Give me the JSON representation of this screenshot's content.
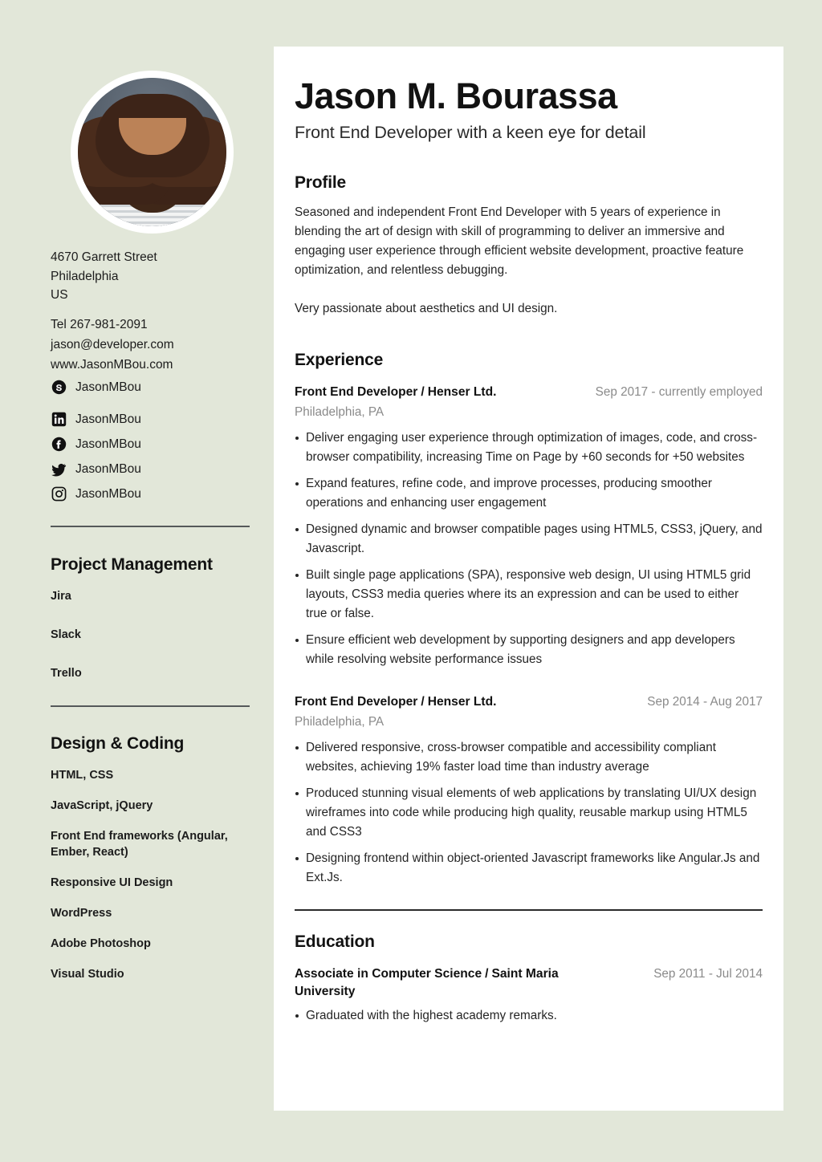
{
  "theme": {
    "background": "#E2E7D9",
    "panel": "#FFFFFF",
    "text": "#252525",
    "muted": "#8A8A8A",
    "rule": "#2B2B2B",
    "sidebar_rule": "#55595A"
  },
  "sidebar": {
    "photo_alt": "portrait-photo",
    "address": {
      "street": "4670 Garrett Street",
      "city": "Philadelphia",
      "country": "US"
    },
    "contact": {
      "phone": "Tel 267-981-2091",
      "email": "jason@developer.com",
      "website": "www.JasonMBou.com"
    },
    "social": [
      {
        "icon": "skype-icon",
        "handle": "JasonMBou"
      },
      {
        "icon": "linkedin-icon",
        "handle": "JasonMBou"
      },
      {
        "icon": "facebook-icon",
        "handle": "JasonMBou"
      },
      {
        "icon": "twitter-icon",
        "handle": "JasonMBou"
      },
      {
        "icon": "instagram-icon",
        "handle": "JasonMBou"
      }
    ],
    "sections": [
      {
        "heading": "Project Management",
        "items": [
          "Jira",
          "Slack",
          "Trello"
        ]
      },
      {
        "heading": "Design & Coding",
        "items": [
          "HTML, CSS",
          "JavaScript, jQuery",
          "Front End frameworks (Angular, Ember, React)",
          "Responsive UI Design",
          "WordPress",
          "Adobe Photoshop",
          "Visual Studio"
        ]
      }
    ]
  },
  "main": {
    "name": "Jason M. Bourassa",
    "tagline": "Front End Developer with a keen eye for detail",
    "profile": {
      "heading": "Profile",
      "paragraphs": [
        "Seasoned and independent Front End Developer with 5 years of experience in blending the art of design with skill of programming to deliver an immersive and engaging user experience through efficient website development, proactive feature optimization, and relentless debugging.",
        "Very passionate about aesthetics and UI design."
      ]
    },
    "experience": {
      "heading": "Experience",
      "jobs": [
        {
          "role": "Front End Developer",
          "separator": "/",
          "company": "Henser Ltd.",
          "date": "Sep 2017 - currently employed",
          "location": "Philadelphia, PA",
          "bullets": [
            "Deliver engaging user experience through optimization of images, code, and cross-browser compatibility, increasing Time on Page by +60 seconds for +50 websites",
            "Expand features, refine code, and improve processes, producing smoother operations and enhancing user engagement",
            "Designed dynamic and browser compatible pages using HTML5, CSS3, jQuery, and Javascript.",
            "Built single page applications (SPA), responsive web design, UI using HTML5 grid layouts, CSS3 media queries where its an expression and can be used to either true or false.",
            "Ensure efficient web development by supporting designers and app developers while resolving website performance issues"
          ]
        },
        {
          "role": "Front End Developer",
          "separator": "/",
          "company": "Henser Ltd.",
          "date": "Sep 2014 - Aug 2017",
          "location": "Philadelphia, PA",
          "bullets": [
            "Delivered responsive, cross-browser compatible and accessibility compliant websites, achieving 19% faster load time than industry average",
            "Produced stunning visual elements of web applications by translating UI/UX design wireframes into code while producing high quality, reusable markup using HTML5 and CSS3",
            "Designing frontend within object-oriented Javascript frameworks like Angular.Js and Ext.Js."
          ]
        }
      ]
    },
    "education": {
      "heading": "Education",
      "entries": [
        {
          "degree": "Associate in Computer Science",
          "separator": "/",
          "school": "Saint Maria University",
          "date": "Sep 2011 - Jul 2014",
          "bullets": [
            "Graduated with the highest academy remarks."
          ]
        }
      ]
    }
  }
}
